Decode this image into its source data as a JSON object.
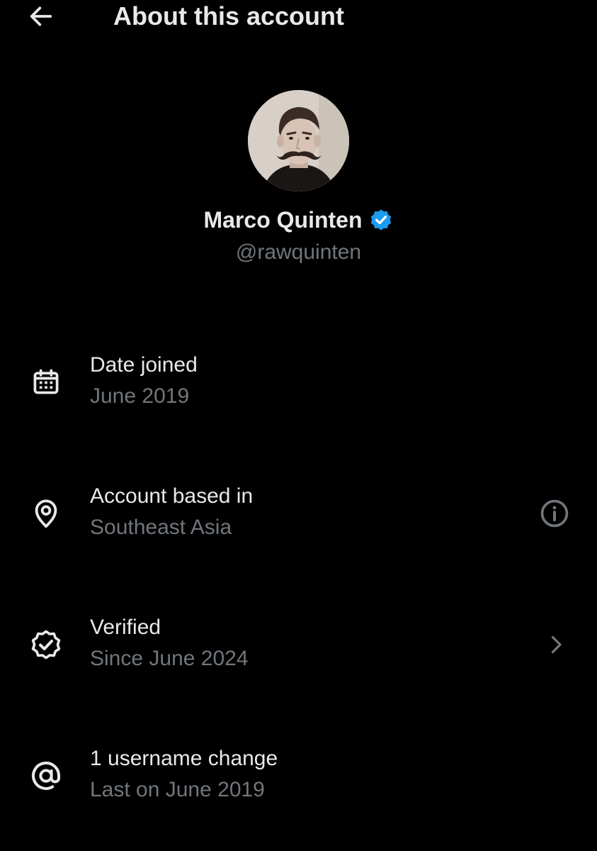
{
  "header": {
    "title": "About this account",
    "back_icon": "arrow-left-icon"
  },
  "profile": {
    "display_name": "Marco Quinten",
    "handle": "@rawquinten",
    "verified_badge_color": "#1d9bf0"
  },
  "rows": [
    {
      "icon": "calendar-icon",
      "label": "Date joined",
      "value": "June 2019"
    },
    {
      "icon": "location-pin-icon",
      "label": "Account based in",
      "value": "Southeast Asia",
      "action_icon": "info-icon"
    },
    {
      "icon": "verified-badge-icon",
      "label": "Verified",
      "value": "Since June 2024",
      "action_icon": "chevron-right-icon"
    },
    {
      "icon": "at-sign-icon",
      "label": "1 username change",
      "value": "Last on June 2019"
    }
  ],
  "colors": {
    "background": "#000000",
    "primary_text": "#e7e9ea",
    "secondary_text": "#71767b",
    "accent": "#1d9bf0"
  }
}
